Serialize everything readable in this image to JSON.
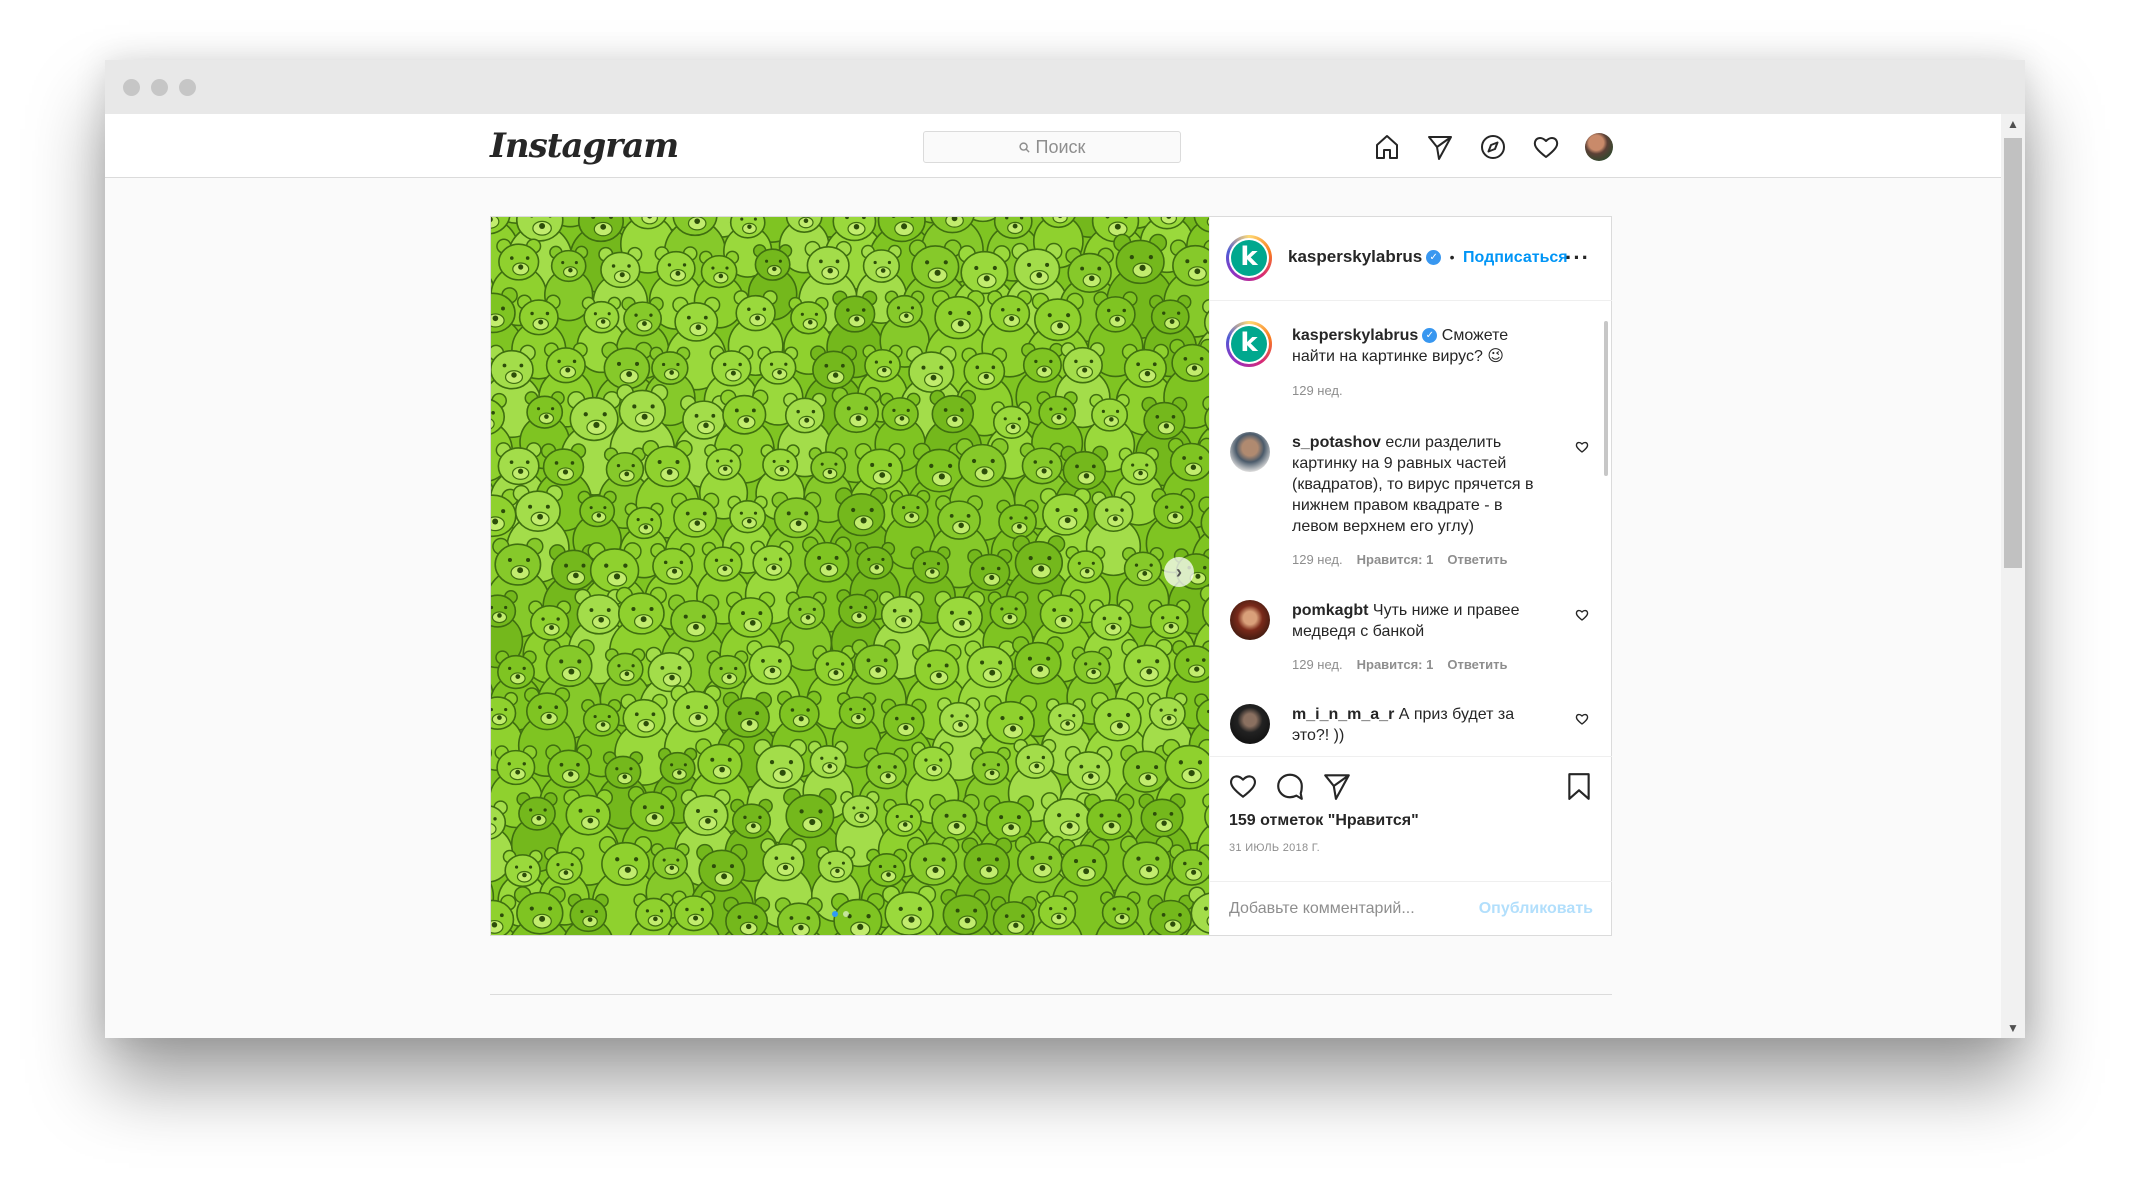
{
  "header": {
    "logo": "Instagram",
    "search_placeholder": "Поиск"
  },
  "post": {
    "author": {
      "username": "kasperskylabrus",
      "avatar_letter": "k",
      "follow_label": "Подписаться",
      "separator": "•"
    },
    "caption": {
      "username": "kasperskylabrus",
      "text": "Сможете найти на картинке вирус? 😉",
      "age": "129 нед."
    },
    "comments": [
      {
        "username": "s_potashov",
        "text": "если разделить картинку на 9 равных частей (квадратов), то вирус прячется в нижнем правом квадрате - в левом верхнем его углу)",
        "age": "129 нед.",
        "likes": "Нравится: 1",
        "reply": "Ответить"
      },
      {
        "username": "pomkagbt",
        "text": "Чуть ниже и правее медведя с банкой",
        "age": "129 нед.",
        "likes": "Нравится: 1",
        "reply": "Ответить"
      },
      {
        "username": "m_i_n_m_a_r",
        "text": "А приз будет за это?! ))"
      }
    ],
    "likes_text": "159 отметок \"Нравится\"",
    "date": "31 ИЮЛЬ 2018 Г.",
    "add_comment_placeholder": "Добавьте комментарий...",
    "publish_label": "Опубликовать",
    "carousel": {
      "count": 2,
      "active": 1
    }
  },
  "colors": {
    "accent": "#0095f6",
    "photo_green": "#7fc422",
    "brand_teal": "#00a88e"
  }
}
